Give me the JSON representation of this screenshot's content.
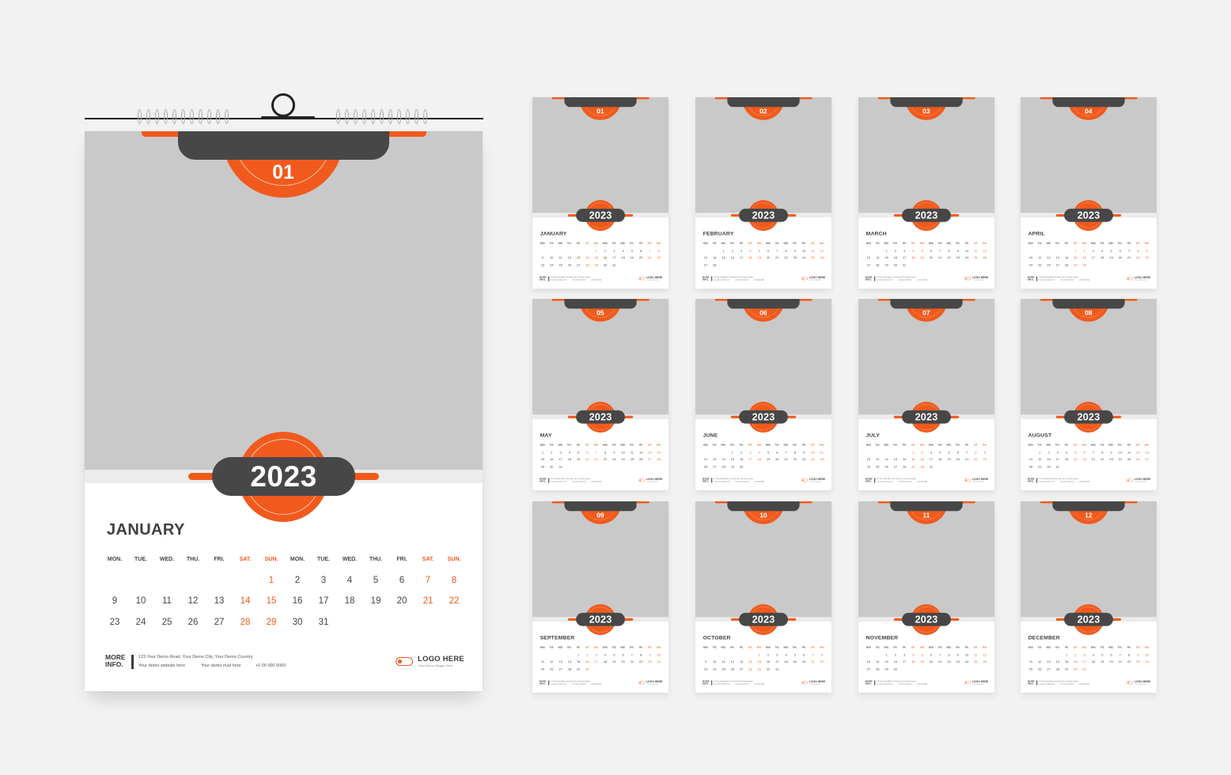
{
  "year": "2023",
  "weekday_headers": [
    "MON.",
    "TUE.",
    "WED.",
    "THU.",
    "FRI.",
    "SAT.",
    "SUN.",
    "MON.",
    "TUE.",
    "WED.",
    "THU.",
    "FRI.",
    "SAT.",
    "SUN."
  ],
  "weekend_columns": [
    5,
    6,
    12,
    13
  ],
  "featured_month": 0,
  "colors": {
    "accent": "#f15a1c",
    "dark": "#474747",
    "photo_placeholder": "#c9c9c9",
    "background": "#f2f2f2"
  },
  "footer": {
    "more_info": "MORE INFO.",
    "address": "123 Your Demo Road, Your Demo City, Your Demo Country",
    "website": "Your demo website here",
    "mail": "Your demo mail here",
    "phone": "+0 00 000 0000",
    "logo_text": "LOGO HERE",
    "slogan": "Your Demo Slogan Here",
    "logo_icon": "toggle-icon"
  },
  "months": [
    {
      "number": "01",
      "name": "JANUARY",
      "weeks": [
        [
          "",
          "",
          "",
          "",
          "",
          "",
          1,
          2,
          3,
          4,
          5,
          6,
          7,
          8
        ],
        [
          9,
          10,
          11,
          12,
          13,
          14,
          15,
          16,
          17,
          18,
          19,
          20,
          21,
          22
        ],
        [
          23,
          24,
          25,
          26,
          27,
          28,
          29,
          30,
          31
        ]
      ]
    },
    {
      "number": "02",
      "name": "FEBRUARY",
      "weeks": [
        [
          "",
          "",
          1,
          2,
          3,
          4,
          5,
          6,
          7,
          8,
          9,
          10,
          11,
          12
        ],
        [
          13,
          14,
          15,
          16,
          17,
          18,
          19,
          20,
          21,
          22,
          23,
          24,
          25,
          26
        ],
        [
          27,
          28
        ]
      ]
    },
    {
      "number": "03",
      "name": "MARCH",
      "weeks": [
        [
          "",
          "",
          1,
          2,
          3,
          4,
          5,
          6,
          7,
          8,
          9,
          10,
          11,
          12
        ],
        [
          13,
          14,
          15,
          16,
          17,
          18,
          19,
          20,
          21,
          22,
          23,
          24,
          25,
          26
        ],
        [
          27,
          28,
          29,
          30,
          31
        ]
      ]
    },
    {
      "number": "04",
      "name": "APRIL",
      "weeks": [
        [
          "",
          "",
          "",
          "",
          "",
          1,
          2,
          3,
          4,
          5,
          6,
          7,
          8,
          9
        ],
        [
          10,
          11,
          12,
          13,
          14,
          15,
          16,
          17,
          18,
          19,
          20,
          21,
          22,
          23
        ],
        [
          24,
          25,
          26,
          27,
          28,
          29,
          30
        ]
      ]
    },
    {
      "number": "05",
      "name": "MAY",
      "weeks": [
        [
          1,
          2,
          3,
          4,
          5,
          6,
          7,
          8,
          9,
          10,
          11,
          12,
          13,
          14
        ],
        [
          15,
          16,
          17,
          18,
          19,
          20,
          21,
          22,
          23,
          24,
          25,
          26,
          27,
          28
        ],
        [
          29,
          30,
          31
        ]
      ]
    },
    {
      "number": "06",
      "name": "JUNE",
      "weeks": [
        [
          "",
          "",
          "",
          1,
          2,
          3,
          4,
          5,
          6,
          7,
          8,
          9,
          10,
          11
        ],
        [
          12,
          13,
          14,
          15,
          16,
          17,
          18,
          19,
          20,
          21,
          22,
          23,
          24,
          25
        ],
        [
          26,
          27,
          28,
          29,
          30
        ]
      ]
    },
    {
      "number": "07",
      "name": "JULY",
      "weeks": [
        [
          "",
          "",
          "",
          "",
          "",
          1,
          2,
          3,
          4,
          5,
          6,
          7,
          8,
          9
        ],
        [
          10,
          11,
          12,
          13,
          14,
          15,
          16,
          17,
          18,
          19,
          20,
          21,
          22,
          23
        ],
        [
          24,
          25,
          26,
          27,
          28,
          29,
          30,
          31
        ]
      ]
    },
    {
      "number": "08",
      "name": "AUGUST",
      "weeks": [
        [
          "",
          1,
          2,
          3,
          4,
          5,
          6,
          7,
          8,
          9,
          10,
          11,
          12,
          13
        ],
        [
          14,
          15,
          16,
          17,
          18,
          19,
          20,
          21,
          22,
          23,
          24,
          25,
          26,
          27
        ],
        [
          28,
          29,
          30,
          31
        ]
      ]
    },
    {
      "number": "09",
      "name": "SEPTEMBER",
      "weeks": [
        [
          "",
          "",
          "",
          "",
          1,
          2,
          3,
          4,
          5,
          6,
          7,
          8,
          9,
          10
        ],
        [
          11,
          12,
          13,
          14,
          15,
          16,
          17,
          18,
          19,
          20,
          21,
          22,
          23,
          24
        ],
        [
          25,
          26,
          27,
          28,
          29,
          30
        ]
      ]
    },
    {
      "number": "10",
      "name": "OCTOBER",
      "weeks": [
        [
          "",
          "",
          "",
          "",
          "",
          "",
          1,
          2,
          3,
          4,
          5,
          6,
          7,
          8
        ],
        [
          9,
          10,
          11,
          12,
          13,
          14,
          15,
          16,
          17,
          18,
          19,
          20,
          21,
          22
        ],
        [
          23,
          24,
          25,
          26,
          27,
          28,
          29,
          30,
          31
        ]
      ]
    },
    {
      "number": "11",
      "name": "NOVEMBER",
      "weeks": [
        [
          "",
          "",
          1,
          2,
          3,
          4,
          5,
          6,
          7,
          8,
          9,
          10,
          11,
          12
        ],
        [
          13,
          14,
          15,
          16,
          17,
          18,
          19,
          20,
          21,
          22,
          23,
          24,
          25,
          26
        ],
        [
          27,
          28,
          29,
          30
        ]
      ]
    },
    {
      "number": "12",
      "name": "DECEMBER",
      "weeks": [
        [
          "",
          "",
          "",
          "",
          1,
          2,
          3,
          4,
          5,
          6,
          7,
          8,
          9,
          10
        ],
        [
          11,
          12,
          13,
          14,
          15,
          16,
          17,
          18,
          19,
          20,
          21,
          22,
          23,
          24
        ],
        [
          25,
          26,
          27,
          28,
          29,
          30,
          31
        ]
      ]
    }
  ]
}
